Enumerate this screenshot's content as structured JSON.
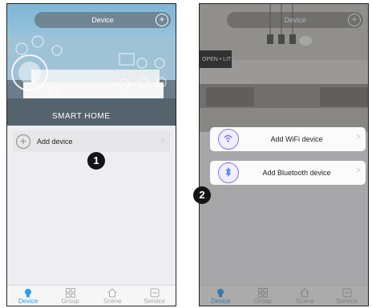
{
  "left": {
    "header": {
      "title": "Device",
      "add_symbol": "+"
    },
    "hero_text": "SMART HOME",
    "list": [
      {
        "label": "Add device",
        "icon": "add-circle-icon",
        "chevron": ">"
      }
    ],
    "tabs": [
      {
        "label": "Device",
        "icon": "bulb-icon",
        "active": true
      },
      {
        "label": "Group",
        "icon": "grid-icon",
        "active": false
      },
      {
        "label": "Scene",
        "icon": "home-icon",
        "active": false
      },
      {
        "label": "Service",
        "icon": "chat-icon",
        "active": false
      }
    ]
  },
  "right": {
    "header": {
      "title": "Device",
      "add_symbol": "+"
    },
    "sign_text": "OPEN • LIT",
    "menu": [
      {
        "label": "Add WiFi device",
        "icon": "wifi-bulb-icon",
        "chevron": ">"
      },
      {
        "label": "Add Bluetooth device",
        "icon": "bluetooth-bulb-icon",
        "chevron": ">"
      }
    ],
    "tabs": [
      {
        "label": "Device",
        "icon": "bulb-icon",
        "active": true
      },
      {
        "label": "Group",
        "icon": "grid-icon",
        "active": false
      },
      {
        "label": "Scene",
        "icon": "home-icon",
        "active": false
      },
      {
        "label": "Service",
        "icon": "chat-icon",
        "active": false
      }
    ]
  },
  "badges": {
    "step1": "1",
    "step2": "2"
  },
  "colors": {
    "accent": "#2d9cf0",
    "bulb_ring": "#7d79e0",
    "badge": "#141414"
  }
}
